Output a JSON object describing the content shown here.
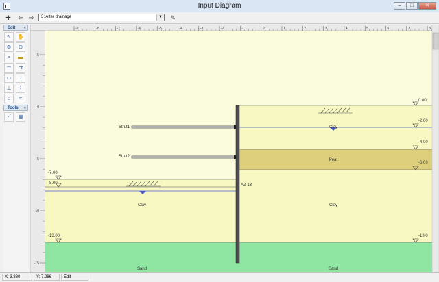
{
  "window": {
    "title": "Input Diagram"
  },
  "toolbar": {
    "stage_value": "3: After drainage"
  },
  "panels": {
    "edit_label": "Edit",
    "tools_label": "Tools"
  },
  "ruler": {
    "top": [
      "-9",
      "-8",
      "-7",
      "-6",
      "-5",
      "-4",
      "-3",
      "-2",
      "-1",
      "0",
      "1",
      "2",
      "3",
      "4",
      "5",
      "6",
      "7",
      "8",
      "9"
    ],
    "left": [
      "5",
      "0",
      "-5",
      "-10",
      "-15"
    ]
  },
  "diagram": {
    "strut1_label": "Strut1",
    "strut2_label": "Strut2",
    "wall_label": "AZ 13",
    "left_levels": [
      "-7.00",
      "-8.00",
      "-13.00"
    ],
    "right_levels": [
      "0.00",
      "-2.00",
      "-4.00",
      "-6.00",
      "-13.0"
    ],
    "left_clay": "Clay",
    "left_sand": "Sand",
    "right_clay_top": "Clay",
    "right_peat": "Peat",
    "right_clay": "Clay",
    "right_sand": "Sand",
    "colors": {
      "clay": "#f7f8c2",
      "peat": "#ddcf7c",
      "sand": "#8fe5a2",
      "background": "#fbfbdd",
      "wall": "#4e4e4e"
    }
  },
  "status": {
    "x": "X: 3.880",
    "y": "Y: 7.286",
    "mode": "Edit"
  }
}
